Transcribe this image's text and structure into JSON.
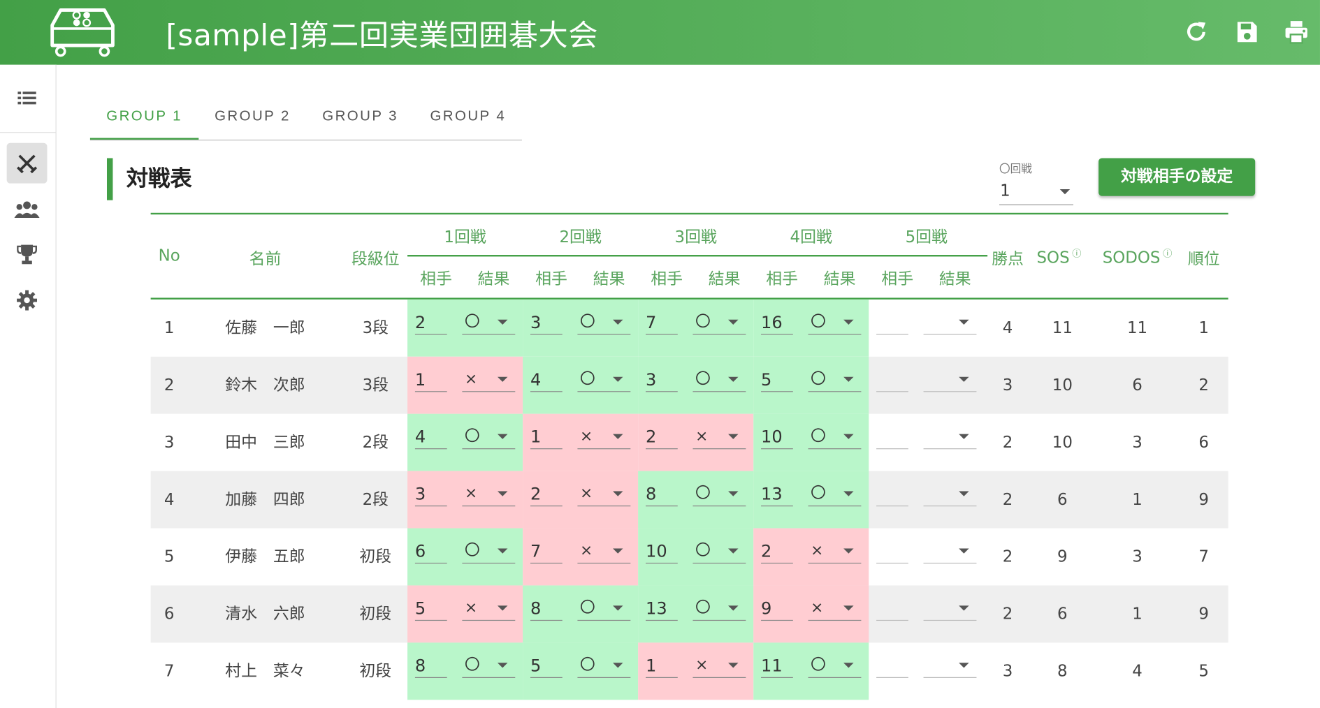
{
  "header": {
    "title": "[sample]第二回実業団囲碁大会",
    "icons": [
      "go-board-logo-icon",
      "refresh-icon",
      "save-icon",
      "print-icon"
    ]
  },
  "sidebar": {
    "items": [
      {
        "icon": "list-icon"
      },
      {
        "icon": "crossed-swords-icon",
        "active": true
      },
      {
        "icon": "group-icon"
      },
      {
        "icon": "trophy-icon"
      },
      {
        "icon": "gear-icon"
      }
    ]
  },
  "tabs": [
    "GROUP 1",
    "GROUP 2",
    "GROUP 3",
    "GROUP 4"
  ],
  "section": {
    "title": "対戦表",
    "round_label": "〇回戦",
    "round_value": "1",
    "set_button": "対戦相手の設定"
  },
  "table": {
    "headers": {
      "no": "No",
      "name": "名前",
      "rank": "段級位",
      "rounds": [
        "1回戦",
        "2回戦",
        "3回戦",
        "4回戦",
        "5回戦"
      ],
      "opp": "相手",
      "res": "結果",
      "points": "勝点",
      "sos": "SOS",
      "sodos": "SODOS",
      "place": "順位",
      "info_mark": "ⓘ"
    },
    "colors": {
      "win": "#b9f6ca",
      "lose": "#ffcdd2",
      "accent": "#43a047"
    },
    "rows": [
      {
        "no": "1",
        "name": "佐藤　一郎",
        "rank": "3段",
        "rounds": [
          {
            "opp": "2",
            "res": "〇"
          },
          {
            "opp": "3",
            "res": "〇"
          },
          {
            "opp": "7",
            "res": "〇"
          },
          {
            "opp": "16",
            "res": "〇"
          },
          {
            "opp": "",
            "res": ""
          }
        ],
        "points": "4",
        "sos": "11",
        "sodos": "11",
        "place": "1"
      },
      {
        "no": "2",
        "name": "鈴木　次郎",
        "rank": "3段",
        "rounds": [
          {
            "opp": "1",
            "res": "×"
          },
          {
            "opp": "4",
            "res": "〇"
          },
          {
            "opp": "3",
            "res": "〇"
          },
          {
            "opp": "5",
            "res": "〇"
          },
          {
            "opp": "",
            "res": ""
          }
        ],
        "points": "3",
        "sos": "10",
        "sodos": "6",
        "place": "2"
      },
      {
        "no": "3",
        "name": "田中　三郎",
        "rank": "2段",
        "rounds": [
          {
            "opp": "4",
            "res": "〇"
          },
          {
            "opp": "1",
            "res": "×"
          },
          {
            "opp": "2",
            "res": "×"
          },
          {
            "opp": "10",
            "res": "〇"
          },
          {
            "opp": "",
            "res": ""
          }
        ],
        "points": "2",
        "sos": "10",
        "sodos": "3",
        "place": "6"
      },
      {
        "no": "4",
        "name": "加藤　四郎",
        "rank": "2段",
        "rounds": [
          {
            "opp": "3",
            "res": "×"
          },
          {
            "opp": "2",
            "res": "×"
          },
          {
            "opp": "8",
            "res": "〇"
          },
          {
            "opp": "13",
            "res": "〇"
          },
          {
            "opp": "",
            "res": ""
          }
        ],
        "points": "2",
        "sos": "6",
        "sodos": "1",
        "place": "9"
      },
      {
        "no": "5",
        "name": "伊藤　五郎",
        "rank": "初段",
        "rounds": [
          {
            "opp": "6",
            "res": "〇"
          },
          {
            "opp": "7",
            "res": "×"
          },
          {
            "opp": "10",
            "res": "〇"
          },
          {
            "opp": "2",
            "res": "×"
          },
          {
            "opp": "",
            "res": ""
          }
        ],
        "points": "2",
        "sos": "9",
        "sodos": "3",
        "place": "7"
      },
      {
        "no": "6",
        "name": "清水　六郎",
        "rank": "初段",
        "rounds": [
          {
            "opp": "5",
            "res": "×"
          },
          {
            "opp": "8",
            "res": "〇"
          },
          {
            "opp": "13",
            "res": "〇"
          },
          {
            "opp": "9",
            "res": "×"
          },
          {
            "opp": "",
            "res": ""
          }
        ],
        "points": "2",
        "sos": "6",
        "sodos": "1",
        "place": "9"
      },
      {
        "no": "7",
        "name": "村上　菜々",
        "rank": "初段",
        "rounds": [
          {
            "opp": "8",
            "res": "〇"
          },
          {
            "opp": "5",
            "res": "〇"
          },
          {
            "opp": "1",
            "res": "×"
          },
          {
            "opp": "11",
            "res": "〇"
          },
          {
            "opp": "",
            "res": ""
          }
        ],
        "points": "3",
        "sos": "8",
        "sodos": "4",
        "place": "5"
      }
    ]
  }
}
